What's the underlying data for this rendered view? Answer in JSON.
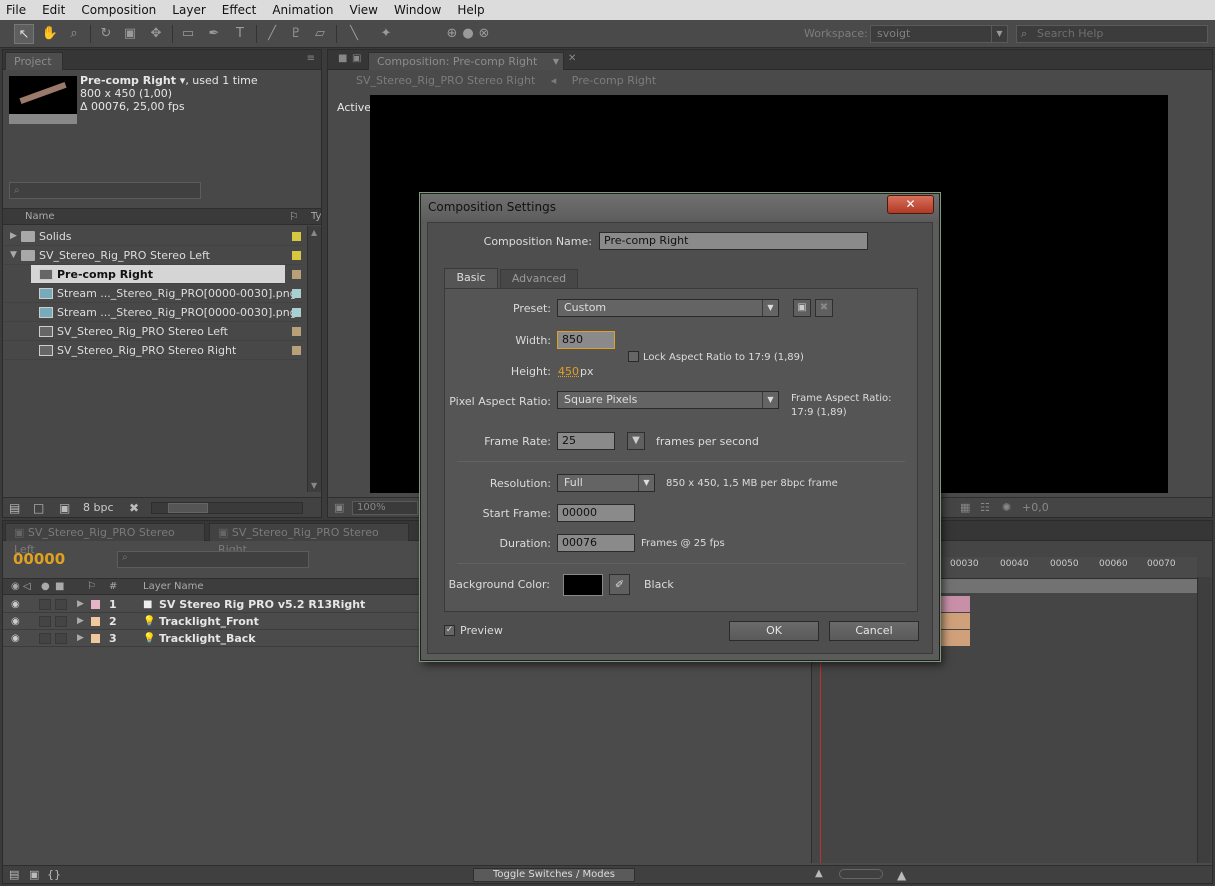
{
  "menubar": {
    "items": [
      "File",
      "Edit",
      "Composition",
      "Layer",
      "Effect",
      "Animation",
      "View",
      "Window",
      "Help"
    ]
  },
  "toolbar": {
    "workspace_label": "Workspace:",
    "workspace_value": "svoigt",
    "search_placeholder": "Search Help"
  },
  "project": {
    "tab_label": "Project",
    "item_name": "Pre-comp Right ▾",
    "item_used": ", used 1 time",
    "item_size": "800 x 450 (1,00)",
    "item_duration": "Δ 00076, 25,00 fps",
    "col_name": "Name",
    "col_type": "Ty",
    "bpc": "8 bpc",
    "rows": [
      {
        "label": "Solids",
        "type": "folder",
        "swatch": "#d8c840"
      },
      {
        "label": "SV_Stereo_Rig_PRO Stereo Left",
        "type": "folder",
        "swatch": "#d8c840"
      },
      {
        "label": "Pre-comp Right",
        "type": "comp",
        "swatch": "#b8a07a"
      },
      {
        "label": "Stream ..._Stereo_Rig_PRO[0000-0030].png",
        "type": "png",
        "swatch": "#a8d0d0"
      },
      {
        "label": "Stream ..._Stereo_Rig_PRO[0000-0030].png",
        "type": "png",
        "swatch": "#a8d0d0"
      },
      {
        "label": "SV_Stereo_Rig_PRO Stereo Left",
        "type": "comp",
        "swatch": "#b8a07a"
      },
      {
        "label": "SV_Stereo_Rig_PRO Stereo Right",
        "type": "comp",
        "swatch": "#b8a07a"
      }
    ]
  },
  "composition": {
    "tab_label": "Composition: Pre-comp Right",
    "breadcrumb_1": "SV_Stereo_Rig_PRO Stereo Right",
    "breadcrumb_2": "Pre-comp Right",
    "view_label": "Active Camera",
    "zoom": "100%",
    "exposure": "+0,0"
  },
  "timeline": {
    "tab_1": "SV_Stereo_Rig_PRO Stereo Left",
    "tab_2": "SV_Stereo_Rig_PRO Stereo Right",
    "timecode": "00000",
    "col_num": "#",
    "col_layer_name": "Layer Name",
    "ruler_ticks": [
      "00030",
      "00040",
      "00050",
      "00060",
      "00070"
    ],
    "toggle_label": "Toggle Switches / Modes",
    "layers": [
      {
        "num": "1",
        "name": "SV Stereo Rig PRO v5.2 R13Right",
        "swatch": "#e6b4c8",
        "bar_color": "#c890a8"
      },
      {
        "num": "2",
        "name": "Tracklight_Front",
        "swatch": "#f0c8a0",
        "bar_color": "#d0a07a"
      },
      {
        "num": "3",
        "name": "Tracklight_Back",
        "swatch": "#f0c8a0",
        "bar_color": "#d0a07a"
      }
    ]
  },
  "dialog": {
    "title": "Composition Settings",
    "close_symbol": "✕",
    "comp_name_label": "Composition Name:",
    "comp_name_value": "Pre-comp Right",
    "tab_basic": "Basic",
    "tab_advanced": "Advanced",
    "preset_label": "Preset:",
    "preset_value": "Custom",
    "width_label": "Width:",
    "width_value": "850",
    "lock_aspect_label": "Lock Aspect Ratio to 17:9 (1,89)",
    "height_label": "Height:",
    "height_value": "450",
    "height_unit": "px",
    "par_label": "Pixel Aspect Ratio:",
    "par_value": "Square Pixels",
    "frame_aspect_label": "Frame Aspect Ratio:",
    "frame_aspect_value": "17:9 (1,89)",
    "frame_rate_label": "Frame Rate:",
    "frame_rate_value": "25",
    "frame_rate_unit": "frames per second",
    "resolution_label": "Resolution:",
    "resolution_value": "Full",
    "resolution_info": "850 x 450, 1,5 MB per 8bpc frame",
    "start_frame_label": "Start Frame:",
    "start_frame_value": "00000",
    "duration_label": "Duration:",
    "duration_value": "00076",
    "duration_info": "Frames @ 25 fps",
    "bg_color_label": "Background Color:",
    "bg_color_name": "Black",
    "preview_label": "Preview",
    "ok_label": "OK",
    "cancel_label": "Cancel"
  }
}
